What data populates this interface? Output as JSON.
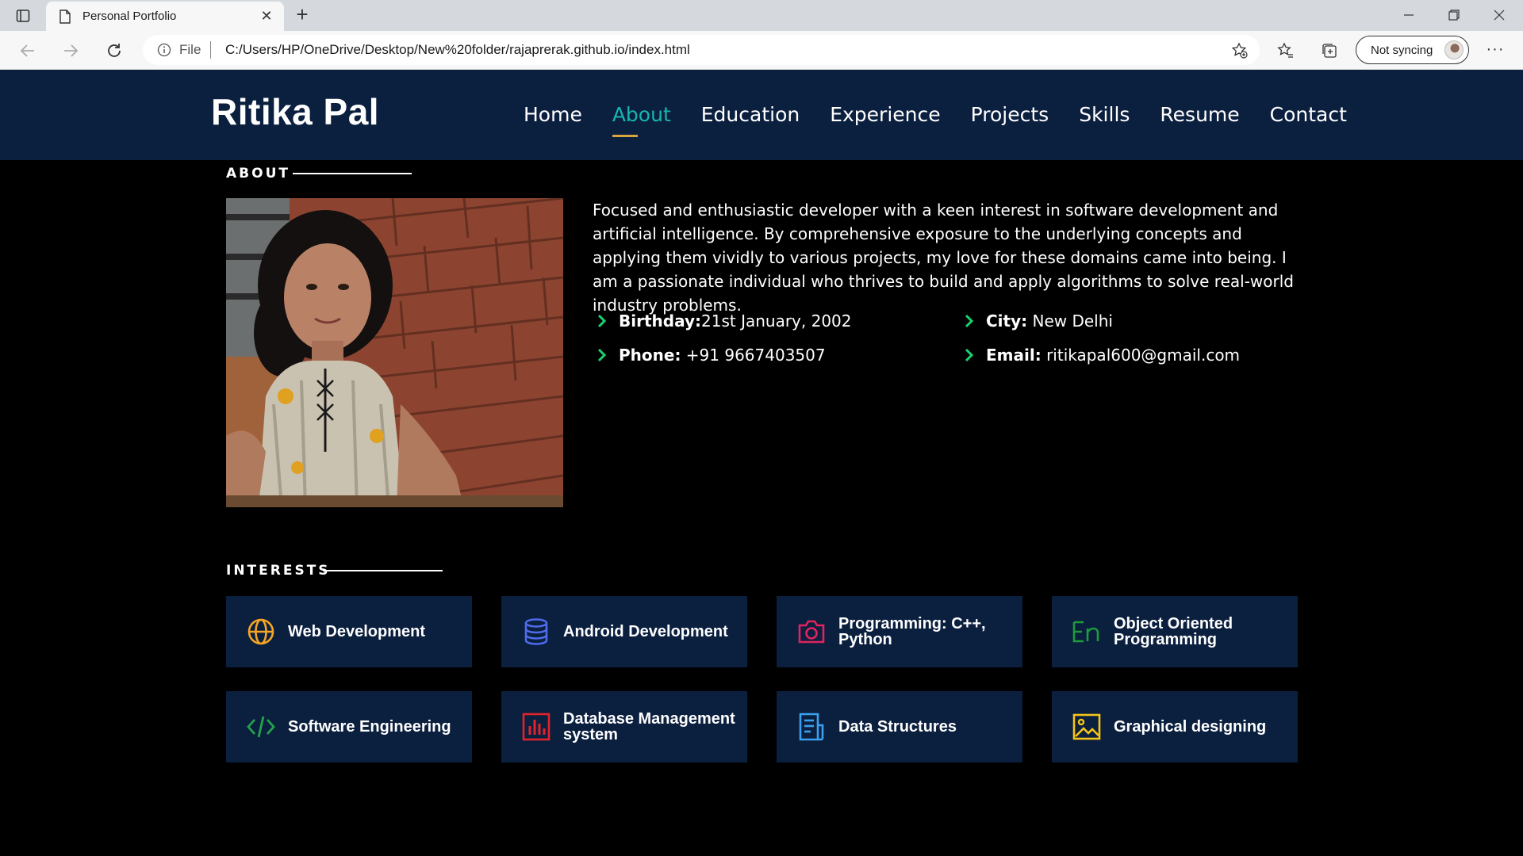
{
  "browser": {
    "tab_title": "Personal Portfolio",
    "url_scheme": "File",
    "url": "C:/Users/HP/OneDrive/Desktop/New%20folder/rajaprerak.github.io/index.html",
    "sync_label": "Not syncing"
  },
  "header": {
    "logo": "Ritika Pal",
    "nav": [
      "Home",
      "About",
      "Education",
      "Experience",
      "Projects",
      "Skills",
      "Resume",
      "Contact"
    ],
    "active_nav": "About"
  },
  "about": {
    "section_title": "ABOUT",
    "description": "Focused and enthusiastic developer with a keen interest in software development and artificial intelligence. By comprehensive exposure to the underlying concepts and applying them vividly to various projects, my love for these domains came into being. I am a passionate individual who thrives to build and apply algorithms to solve real-world industry problems.",
    "details": {
      "birthday_label": "Birthday:",
      "birthday_value": "21st January, 2002",
      "city_label": "City:",
      "city_value": " New Delhi",
      "phone_label": "Phone:",
      "phone_value": " +91 9667403507",
      "email_label": "Email:",
      "email_value": " ritikapal600@gmail.com"
    }
  },
  "interests": {
    "section_title": "INTERESTS",
    "items": [
      {
        "label": "Web Development",
        "icon": "globe-icon",
        "color": "#f5a623"
      },
      {
        "label": "Android Development",
        "icon": "database-icon",
        "color": "#4f6bed"
      },
      {
        "label": "Programming: C++, Python",
        "icon": "camera-icon",
        "color": "#e0245e"
      },
      {
        "label": "Object Oriented Programming",
        "icon": "en-text-icon",
        "color": "#1e9b3c"
      },
      {
        "label": "Software Engineering",
        "icon": "code-icon",
        "color": "#22a34a"
      },
      {
        "label": "Database Management system",
        "icon": "bar-chart-icon",
        "color": "#e0242c"
      },
      {
        "label": "Data Structures",
        "icon": "document-icon",
        "color": "#3aa0f0"
      },
      {
        "label": "Graphical designing",
        "icon": "image-icon",
        "color": "#f5c518"
      }
    ]
  },
  "colors": {
    "header_bg": "#0b1f3f",
    "accent": "#18b5b0",
    "underline": "#d9a53a",
    "chevron": "#18d26e"
  }
}
